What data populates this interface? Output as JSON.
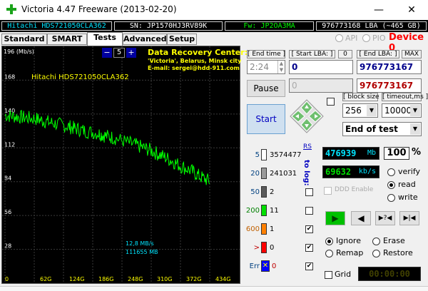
{
  "window": {
    "title": "Victoria 4.47  Freeware (2013-02-20)",
    "minimize": "—",
    "close": "✕"
  },
  "infobar": {
    "model": "Hitachi HDS721050CLA362",
    "serial": "SN: JP1570HJ3RV89K",
    "firmware": "Fw: JP2OA3MA",
    "lba": "976773168 LBA (~465 GB)"
  },
  "tabs": [
    "Standard",
    "SMART",
    "Tests",
    "Advanced",
    "Setup"
  ],
  "mode": {
    "api": "API",
    "pio": "PIO",
    "device": "Device 0"
  },
  "graph": {
    "y_unit": "196 (Mb/s)",
    "y_ticks": [
      "168",
      "140",
      "112",
      "84",
      "56",
      "28"
    ],
    "x_ticks": [
      "0",
      "62G",
      "124G",
      "186G",
      "248G",
      "310G",
      "372G",
      "434G"
    ],
    "drive_label": "Hitachi HDS721050CLA362",
    "speed_text": "12,8 MB/s",
    "pos_text": "111655 MB",
    "stepper_minus": "−",
    "stepper_value": "5",
    "stepper_plus": "+",
    "info_line1": "Data Recovery Center:",
    "info_line2": "'Victoria', Belarus, Minsk city",
    "info_line3": "E-mail: sergei@hdd-911.com"
  },
  "chart_data": {
    "type": "line",
    "title": "",
    "xlabel": "",
    "ylabel": "Mb/s",
    "ylim": [
      0,
      196
    ],
    "x_ticks": [
      "0",
      "62G",
      "124G",
      "186G",
      "248G",
      "310G",
      "372G",
      "434G"
    ],
    "series": [
      {
        "x": [
          0,
          20,
          40,
          62,
          80,
          100,
          124,
          140,
          160,
          186,
          200,
          220,
          248,
          270,
          290,
          310,
          330,
          350,
          372,
          390,
          410
        ],
        "y": [
          139,
          138,
          137,
          136,
          134,
          132,
          130,
          128,
          126,
          124,
          122,
          120,
          116,
          113,
          110,
          106,
          102,
          97,
          93,
          88,
          84
        ]
      }
    ]
  },
  "controls": {
    "end_time_label": "[ End time ]",
    "end_time_value": "2:24",
    "start_lba_label": "[ Start LBA: ]",
    "start_lba_badge": "0",
    "end_lba_label": "[ End LBA: ]",
    "end_lba_badge": "MAX",
    "start_lba_value": "0",
    "end_lba_value": "976773167",
    "current_lba_value": "976773167",
    "pause_label": "Pause",
    "start_label": "Start",
    "block_size_label": "[ block size ]",
    "block_size_value": "256",
    "timeout_label": "[ timeout,ms ]",
    "timeout_value": "10000",
    "end_action_value": "End of test"
  },
  "stats": {
    "rs_label": "RS",
    "to_log_label": "to log:",
    "rows": [
      {
        "threshold": "5",
        "color": "#ffffff",
        "count": "3574477",
        "logged": false
      },
      {
        "threshold": "20",
        "color": "#9a9a9a",
        "count": "241031",
        "logged": false
      },
      {
        "threshold": "50",
        "color": "#5a5a5a",
        "count": "2",
        "logged": false
      },
      {
        "threshold": "200",
        "color": "#00e000",
        "count": "11",
        "logged": false
      },
      {
        "threshold": "600",
        "color": "#ff8000",
        "count": "1",
        "logged": true
      },
      {
        "threshold": ">",
        "color": "#ff0000",
        "count": "0",
        "logged": true
      },
      {
        "threshold": "Err",
        "color": "#0000ff",
        "count": "0",
        "logged": true
      }
    ],
    "err_mark": "✕"
  },
  "progress": {
    "position_value": "476939",
    "position_unit": "Mb",
    "percent": "100",
    "percent_unit": "%",
    "speed_value": "69632",
    "speed_unit": "kb/s",
    "ddd_enable": "DDD Enable",
    "verify": "verify",
    "read": "read",
    "write": "write"
  },
  "actions": {
    "ignore": "Ignore",
    "erase": "Erase",
    "remap": "Remap",
    "restore": "Restore",
    "grid": "Grid",
    "timer": "00:00:00",
    "play_icon": "▶",
    "back_icon": "◀",
    "skip_icon": "▶?◀",
    "end_icon": "▶|◀"
  }
}
